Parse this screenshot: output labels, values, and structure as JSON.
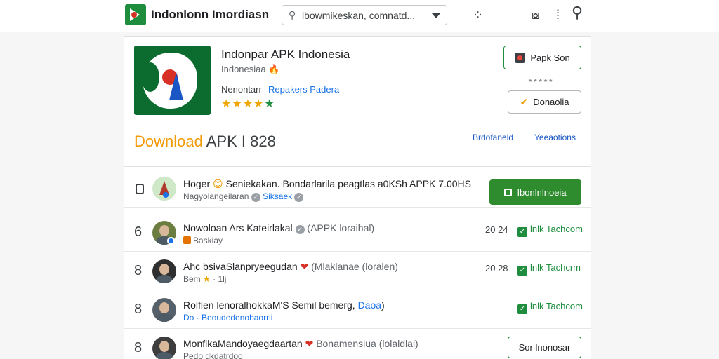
{
  "header": {
    "brand": "Indonlonn Imordiasn",
    "search_placeholder": "lbowmikeskan, comnatd...",
    "icons": [
      "grid-dots-icon",
      "camera-icon",
      "bookmark-icon",
      "search-icon"
    ]
  },
  "app": {
    "title": "Indonpar APK Indonesia",
    "subtitle": "Indonesiaa",
    "meta_label": "Nenontarr",
    "meta_link": "Repakers Padera",
    "stars_gold": "★★★★",
    "stars_green": "★",
    "primary_button": "Papk Son",
    "secondary_button": "Donaolia",
    "small_stars": "★★★★★"
  },
  "download": {
    "title_highlight": "Download",
    "title_rest": " APK I 828",
    "link_1": "Brdofaneld",
    "link_2": "Yeeaotions"
  },
  "rows": [
    {
      "title": "Hoger",
      "title_emoji": "😊",
      "title_rest": " Seniekakan. Bondarlarila peagtlas a0KSh APPK 7.00HS",
      "sub": "Nagyolangeilaran",
      "sub_link": "Siksaek",
      "button": "Ibonlnlnoeia"
    },
    {
      "num": "6",
      "title": "Nowoloan Ars Kateirlakal",
      "title_muted": "(APPK loraihal)",
      "sub": "Baskiay",
      "date": "20 24",
      "check": "lnlk Tachcom"
    },
    {
      "num": "8",
      "title": "Ahc bsivaSlanpryeegudan",
      "title_muted": "(Mlaklanae (loralen)",
      "sub": "Bem",
      "sub_star": "★",
      "sub_rest": "· 1lj",
      "date": "20 28",
      "check": "lnlk Tachcrm"
    },
    {
      "num": "8",
      "title": "Rolflen lenoralhokkaM'S Semil bemerg,",
      "title_link": "Daoa",
      "title_tail": ")",
      "sub": "Do · Beoudedenobaorrii",
      "check": "lnlk Tachcom"
    },
    {
      "num": "8",
      "title": "MonfikaMandoyaegdaartan",
      "title_muted": "Bonamensiua (lolaldlal)",
      "sub": "Pedo dkdatrdoo",
      "button": "Sor lnonosar"
    }
  ]
}
